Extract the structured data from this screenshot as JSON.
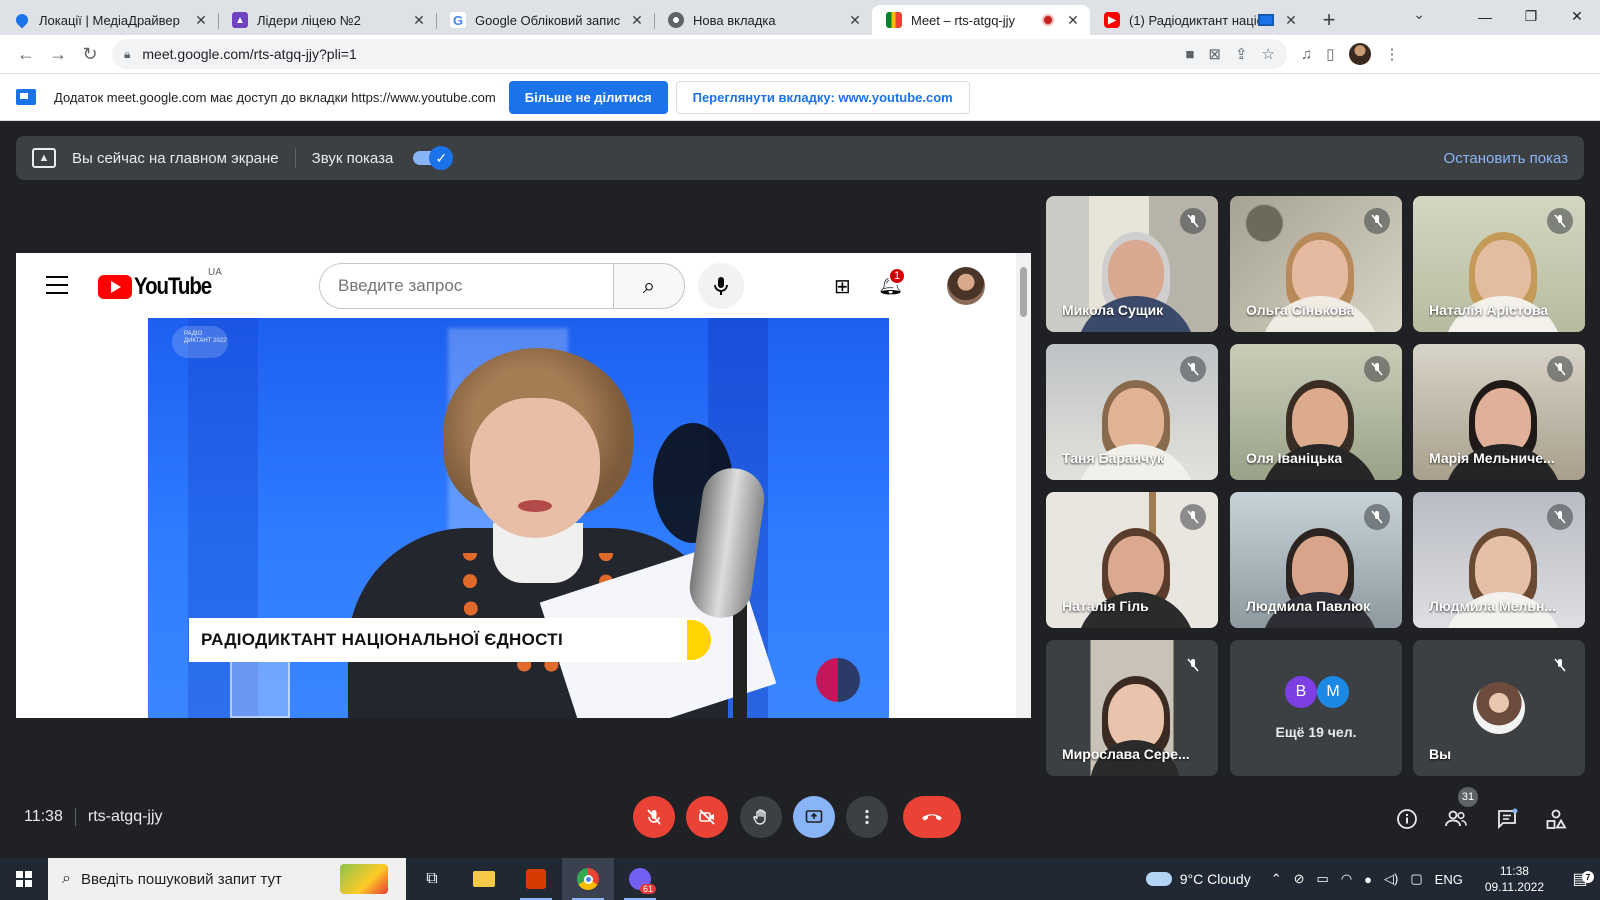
{
  "browser": {
    "tabs": [
      {
        "title": "Локації | МедіаДрайвер",
        "icon": "map-pin-icon",
        "color": "#1a73e8"
      },
      {
        "title": "Лідери ліцею №2",
        "icon": "classroom-icon",
        "color": "#6f42c1"
      },
      {
        "title": "Google Обліковий запис",
        "icon": "google-icon",
        "color": "#4285f4"
      },
      {
        "title": "Нова вкладка",
        "icon": "chrome-icon",
        "color": "#5f6368"
      },
      {
        "title": "Meet – rts-atgq-jjy",
        "icon": "meet-icon",
        "color": "#00832d"
      },
      {
        "title": "(1) Радіодиктант націо",
        "icon": "youtube-icon",
        "color": "#ff0000"
      }
    ],
    "url": "meet.google.com/rts-atgq-jjy?pli=1"
  },
  "infobar": {
    "message": "Додаток meet.google.com має доступ до вкладки https://www.youtube.com",
    "stop_sharing": "Більше не ділитися",
    "view_tab": "Переглянути вкладку: www.youtube.com"
  },
  "meet": {
    "presenting_text": "Вы сейчас на главном экране",
    "sound_label": "Звук показа",
    "stop_presenting": "Остановить показ",
    "time": "11:38",
    "meeting_code": "rts-atgq-jjy",
    "people_count": "31",
    "more_people": "Ещё 19 чел.",
    "more_avatars": [
      {
        "letter": "В",
        "color": "#7b3fe4"
      },
      {
        "letter": "М",
        "color": "#1e88e5"
      }
    ],
    "participants": [
      {
        "name": "Микола Сущик"
      },
      {
        "name": "Ольга Сінькова"
      },
      {
        "name": "Наталія Арістова"
      },
      {
        "name": "Таня Баранчук"
      },
      {
        "name": "Оля Іваніцька"
      },
      {
        "name": "Марія Мельниче..."
      },
      {
        "name": "Наталія Гіль"
      },
      {
        "name": "Людмила Павлюк"
      },
      {
        "name": "Людмила Мельн..."
      },
      {
        "name": "Мирослава Сере..."
      }
    ],
    "self_label": "Вы"
  },
  "youtube": {
    "region": "UA",
    "search_placeholder": "Введите запрос",
    "notification_count": "1",
    "video_caption": "РАДІОДИКТАНТ НАЦІОНАЛЬНОЇ ЄДНОСТІ",
    "watermark": "РАДІО ДИКТАНТ 2022"
  },
  "taskbar": {
    "search_placeholder": "Введіть пошуковий запит тут",
    "weather": "9°C  Cloudy",
    "language": "ENG",
    "time": "11:38",
    "date": "09.11.2022",
    "viber_badge": "61",
    "notification_count": "7"
  }
}
